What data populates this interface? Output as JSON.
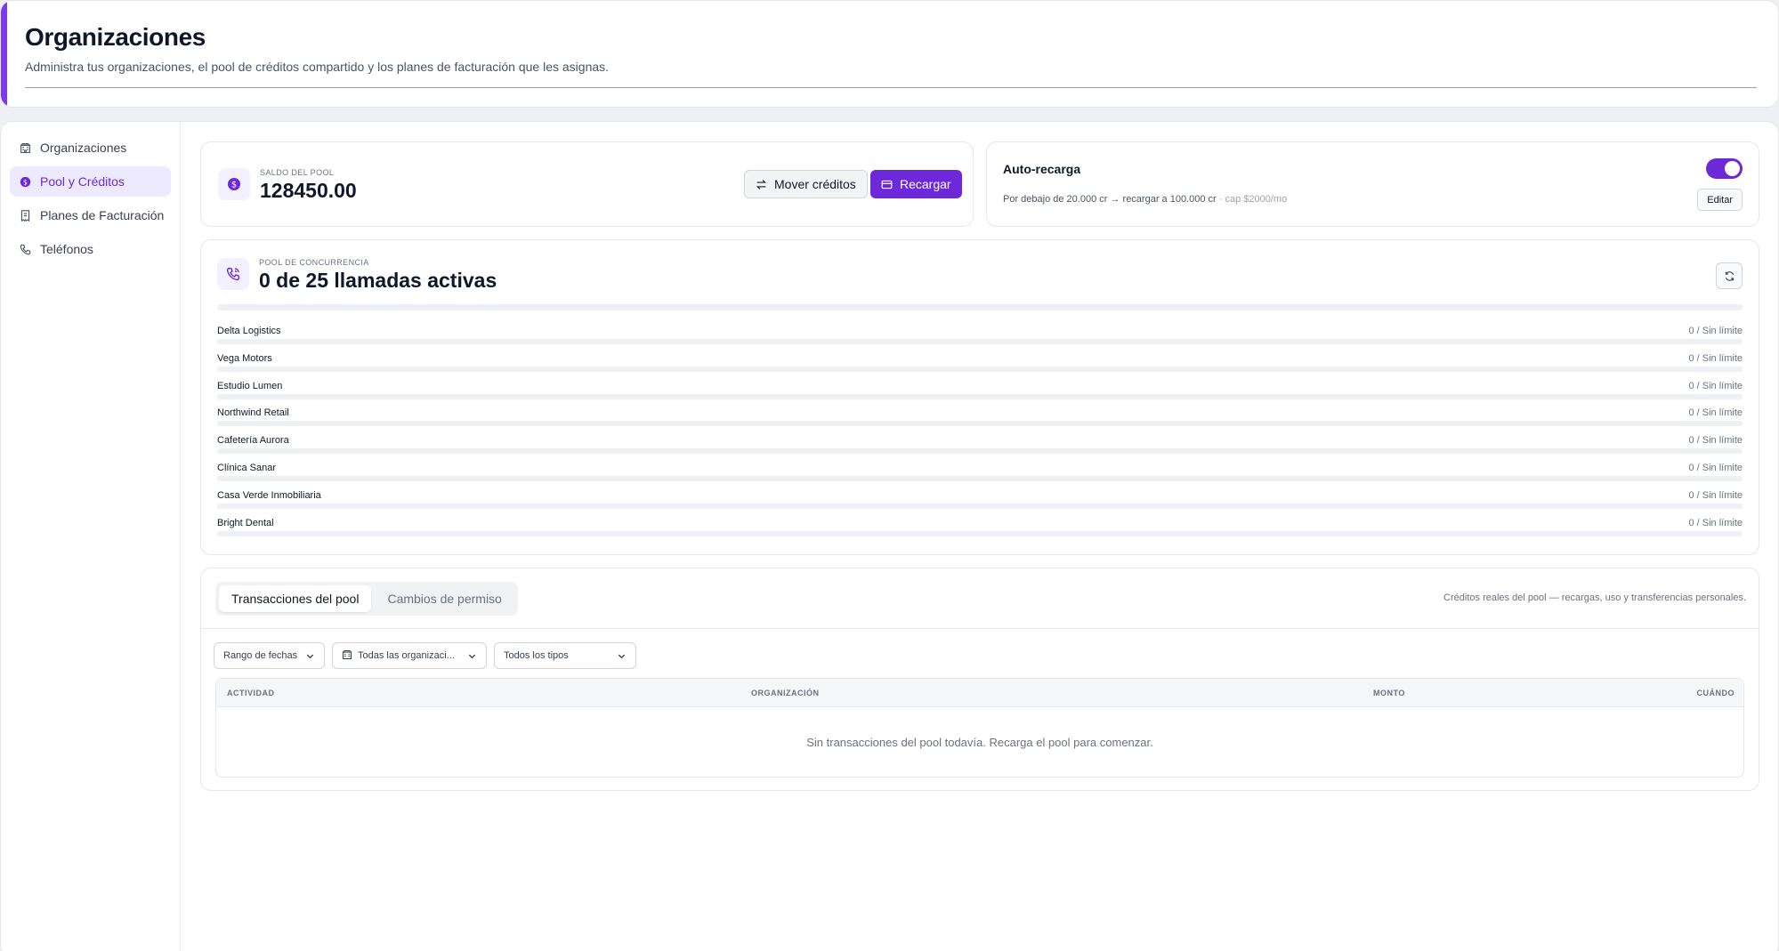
{
  "header": {
    "title": "Organizaciones",
    "subtitle": "Administra tus organizaciones, el pool de créditos compartido y los planes de facturación que les asignas."
  },
  "sidebar": {
    "items": [
      {
        "label": "Organizaciones",
        "icon": "building-icon",
        "active": false
      },
      {
        "label": "Pool y Créditos",
        "icon": "coin-icon",
        "active": true
      },
      {
        "label": "Planes de Facturación",
        "icon": "receipt-icon",
        "active": false
      },
      {
        "label": "Teléfonos",
        "icon": "phone-icon",
        "active": false
      }
    ]
  },
  "balance": {
    "label": "SALDO DEL POOL",
    "value": "128450.00",
    "move_label": "Mover créditos",
    "recharge_label": "Recargar"
  },
  "autorecharge": {
    "title": "Auto-recarga",
    "enabled": true,
    "description": "Por debajo de 20.000 cr → recargar a 100.000 cr",
    "cap": " · cap $2000/mo",
    "edit_label": "Editar"
  },
  "concurrency": {
    "label": "POOL DE CONCURRENCIA",
    "headline": "0 de 25 llamadas activas",
    "orgs": [
      {
        "name": "Delta Logistics",
        "value": "0 / Sin límite"
      },
      {
        "name": "Vega Motors",
        "value": "0 / Sin límite"
      },
      {
        "name": "Estudio Lumen",
        "value": "0 / Sin límite"
      },
      {
        "name": "Northwind Retail",
        "value": "0 / Sin límite"
      },
      {
        "name": "Cafetería Aurora",
        "value": "0 / Sin límite"
      },
      {
        "name": "Clínica Sanar",
        "value": "0 / Sin límite"
      },
      {
        "name": "Casa Verde Inmobiliaria",
        "value": "0 / Sin límite"
      },
      {
        "name": "Bright Dental",
        "value": "0 / Sin límite"
      }
    ]
  },
  "transactions": {
    "tabs": [
      "Transacciones del pool",
      "Cambios de permiso"
    ],
    "active_tab": 0,
    "note": "Créditos reales del pool — recargas, uso y transferencias personales.",
    "filters": {
      "date": "Rango de fechas",
      "org": "Todas las organizaci...",
      "type": "Todos los tipos"
    },
    "columns": [
      "ACTIVIDAD",
      "ORGANIZACIÓN",
      "MONTO",
      "CUÁNDO"
    ],
    "empty": "Sin transacciones del pool todavía. Recarga el pool para comenzar."
  },
  "colors": {
    "accent": "#6d28d9",
    "accent_light": "#ede9fe"
  }
}
